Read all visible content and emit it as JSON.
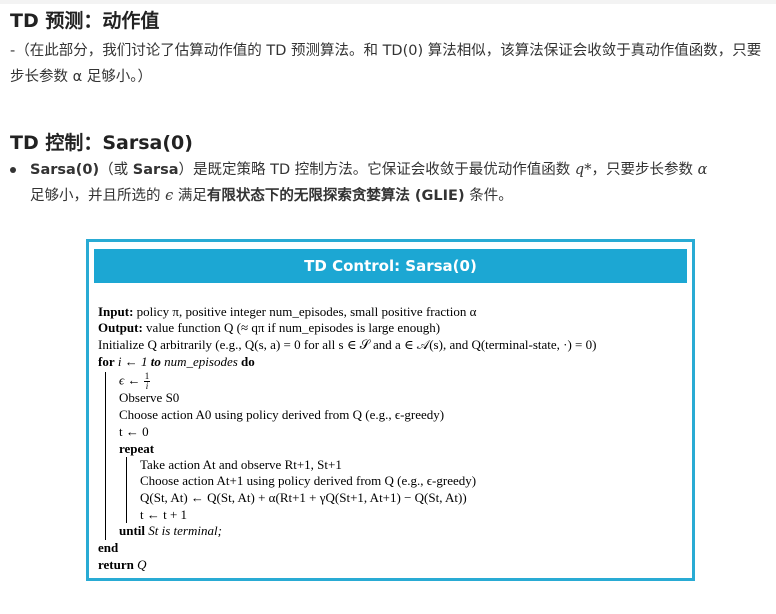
{
  "section1": {
    "title": "TD 预测：动作值",
    "paragraph": "-（在此部分，我们讨论了估算动作值的 TD 预测算法。和 TD(0) 算法相似，该算法保证会收敛于真动作值函数，只要步长参数 α 足够小。）"
  },
  "section2": {
    "title": "TD 控制：Sarsa(0)",
    "bullet": {
      "bold1": "Sarsa(0)",
      "t1": "（或 ",
      "bold2": "Sarsa",
      "t2": "）是既定策略 TD 控制方法。它保证会收敛于最优动作值函数 ",
      "sym1": "q*",
      "t3": "，只要步长参数 ",
      "sym2": "α",
      "t4": "足够小，并且所选的 ",
      "sym3": "ϵ",
      "t5": " 满足",
      "bold3": "有限状态下的无限探索贪婪算法 (GLIE)",
      "t6": " 条件。"
    }
  },
  "algorithm": {
    "title": "TD Control: Sarsa(0)",
    "lines": {
      "input_kw": "Input:",
      "input": " policy π, positive integer num_episodes, small positive fraction α",
      "output_kw": "Output:",
      "output": " value function Q (≈ qπ if num_episodes is large enough)",
      "init": "Initialize Q arbitrarily (e.g., Q(s, a) = 0 for all s ∈ 𝒮 and a ∈ 𝒜(s), and Q(terminal-state, ·) = 0)",
      "for_kw": "for",
      "for_mid": " i ← 1 ",
      "to_kw": "to",
      "for_end": " num_episodes ",
      "do_kw": "do",
      "eps_a": "ϵ ← ",
      "eps_num": "1",
      "eps_den": "i",
      "observe": "Observe S0",
      "choose0": "Choose action A0 using policy derived from Q (e.g., ϵ-greedy)",
      "t0": "t ← 0",
      "repeat_kw": "repeat",
      "take": "Take action At and observe Rt+1, St+1",
      "choose1": "Choose action At+1 using policy derived from Q (e.g., ϵ-greedy)",
      "update": "Q(St, At) ← Q(St, At) + α(Rt+1 + γQ(St+1, At+1) − Q(St, At))",
      "tinc": "t ← t + 1",
      "until_kw": "until",
      "until": " St is terminal;",
      "end_kw": "end",
      "return_kw": "return",
      "return": " Q"
    }
  },
  "colors": {
    "accent": "#1ca7d3",
    "border": "#29abd4"
  }
}
